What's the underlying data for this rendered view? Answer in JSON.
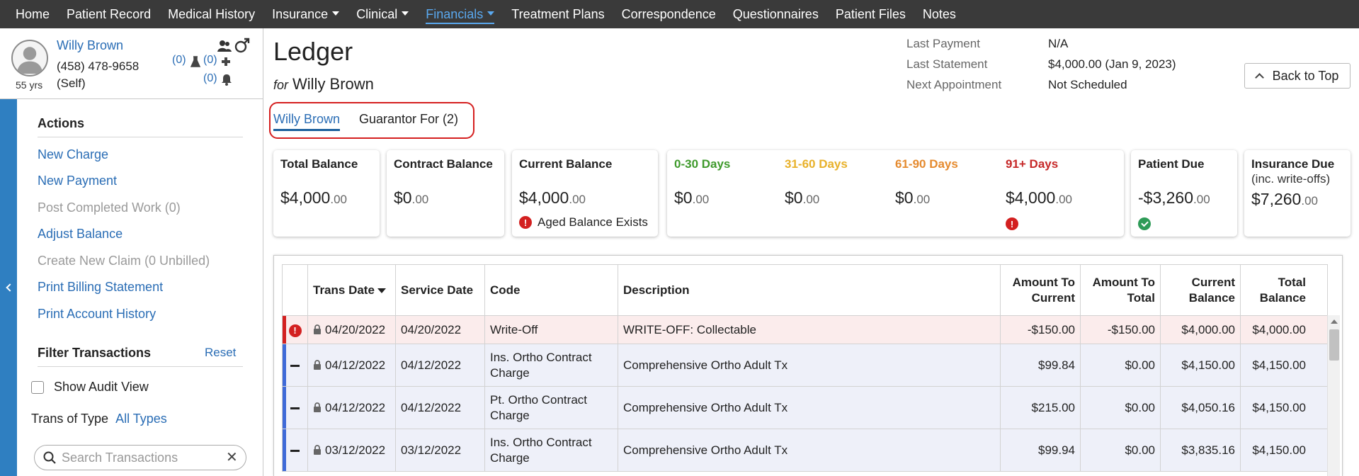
{
  "nav": {
    "items": [
      {
        "label": "Home",
        "dropdown": false
      },
      {
        "label": "Patient Record",
        "dropdown": false
      },
      {
        "label": "Medical History",
        "dropdown": false
      },
      {
        "label": "Insurance",
        "dropdown": true
      },
      {
        "label": "Clinical",
        "dropdown": true
      },
      {
        "label": "Financials",
        "dropdown": true,
        "active": true
      },
      {
        "label": "Treatment Plans",
        "dropdown": false
      },
      {
        "label": "Correspondence",
        "dropdown": false
      },
      {
        "label": "Questionnaires",
        "dropdown": false
      },
      {
        "label": "Patient Files",
        "dropdown": false
      },
      {
        "label": "Notes",
        "dropdown": false
      }
    ]
  },
  "patient": {
    "name": "Willy Brown",
    "phone": "(458) 478-9658",
    "relation": "(Self)",
    "age": "55 yrs",
    "lab_count": "(0)",
    "medical_alert_count": "(0)",
    "notification_count": "(0)"
  },
  "ledger": {
    "title": "Ledger",
    "for_word": "for",
    "for_name": "Willy Brown"
  },
  "summary": {
    "last_payment_label": "Last Payment",
    "last_payment_value": "N/A",
    "last_statement_label": "Last Statement",
    "last_statement_value": "$4,000.00 (Jan 9, 2023)",
    "next_appt_label": "Next Appointment",
    "next_appt_value": "Not Scheduled"
  },
  "back_to_top": "Back to Top",
  "sidebar": {
    "actions_heading": "Actions",
    "actions": [
      {
        "label": "New Charge",
        "disabled": false
      },
      {
        "label": "New Payment",
        "disabled": false
      },
      {
        "label": "Post Completed Work (0)",
        "disabled": true
      },
      {
        "label": "Adjust Balance",
        "disabled": false
      },
      {
        "label": "Create New Claim (0 Unbilled)",
        "disabled": true
      },
      {
        "label": "Print Billing Statement",
        "disabled": false
      },
      {
        "label": "Print Account History",
        "disabled": false
      }
    ],
    "filter_heading": "Filter Transactions",
    "reset": "Reset",
    "audit_label": "Show Audit View",
    "type_label": "Trans of Type",
    "type_value": "All Types",
    "search_placeholder": "Search Transactions"
  },
  "tabs": {
    "active": "Willy Brown",
    "other": "Guarantor For (2)"
  },
  "cards": {
    "total_balance": {
      "label": "Total Balance",
      "dollars": "$4,000",
      "cents": ".00"
    },
    "contract_balance": {
      "label": "Contract Balance",
      "dollars": "$0",
      "cents": ".00"
    },
    "current_balance": {
      "label": "Current Balance",
      "dollars": "$4,000",
      "cents": ".00",
      "note": "Aged Balance Exists"
    },
    "aging": [
      {
        "label": "0-30 Days",
        "dollars": "$0",
        "cents": ".00",
        "color": "#3f9a2c"
      },
      {
        "label": "31-60 Days",
        "dollars": "$0",
        "cents": ".00",
        "color": "#e8b12a"
      },
      {
        "label": "61-90 Days",
        "dollars": "$0",
        "cents": ".00",
        "color": "#e58a2e"
      },
      {
        "label": "91+ Days",
        "dollars": "$4,000",
        "cents": ".00",
        "color": "#c62828"
      }
    ],
    "patient_due": {
      "label": "Patient Due",
      "dollars": "-$3,260",
      "cents": ".00"
    },
    "insurance_due": {
      "label": "Insurance Due",
      "sub": "(inc. write-offs)",
      "dollars": "$7,260",
      "cents": ".00"
    }
  },
  "table": {
    "headers": {
      "trans_date": "Trans Date",
      "service_date": "Service Date",
      "code": "Code",
      "description": "Description",
      "amount_to_current": "Amount To Current",
      "amount_to_total": "Amount To Total",
      "current_balance": "Current Balance",
      "total_balance": "Total Balance"
    },
    "rows": [
      {
        "trans_date": "04/20/2022",
        "service_date": "04/20/2022",
        "code": "Write-Off",
        "description": "WRITE-OFF: Collectable",
        "amount_to_current": "-$150.00",
        "amount_to_total": "-$150.00",
        "current_balance": "$4,000.00",
        "total_balance": "$4,000.00"
      },
      {
        "trans_date": "04/12/2022",
        "service_date": "04/12/2022",
        "code": "Ins. Ortho Contract Charge",
        "description": "Comprehensive Ortho Adult Tx",
        "amount_to_current": "$99.84",
        "amount_to_total": "$0.00",
        "current_balance": "$4,150.00",
        "total_balance": "$4,150.00"
      },
      {
        "trans_date": "04/12/2022",
        "service_date": "04/12/2022",
        "code": "Pt. Ortho Contract Charge",
        "description": "Comprehensive Ortho Adult Tx",
        "amount_to_current": "$215.00",
        "amount_to_total": "$0.00",
        "current_balance": "$4,050.16",
        "total_balance": "$4,150.00"
      },
      {
        "trans_date": "03/12/2022",
        "service_date": "03/12/2022",
        "code": "Ins. Ortho Contract Charge",
        "description": "Comprehensive Ortho Adult Tx",
        "amount_to_current": "$99.94",
        "amount_to_total": "$0.00",
        "current_balance": "$3,835.16",
        "total_balance": "$4,150.00"
      }
    ]
  }
}
